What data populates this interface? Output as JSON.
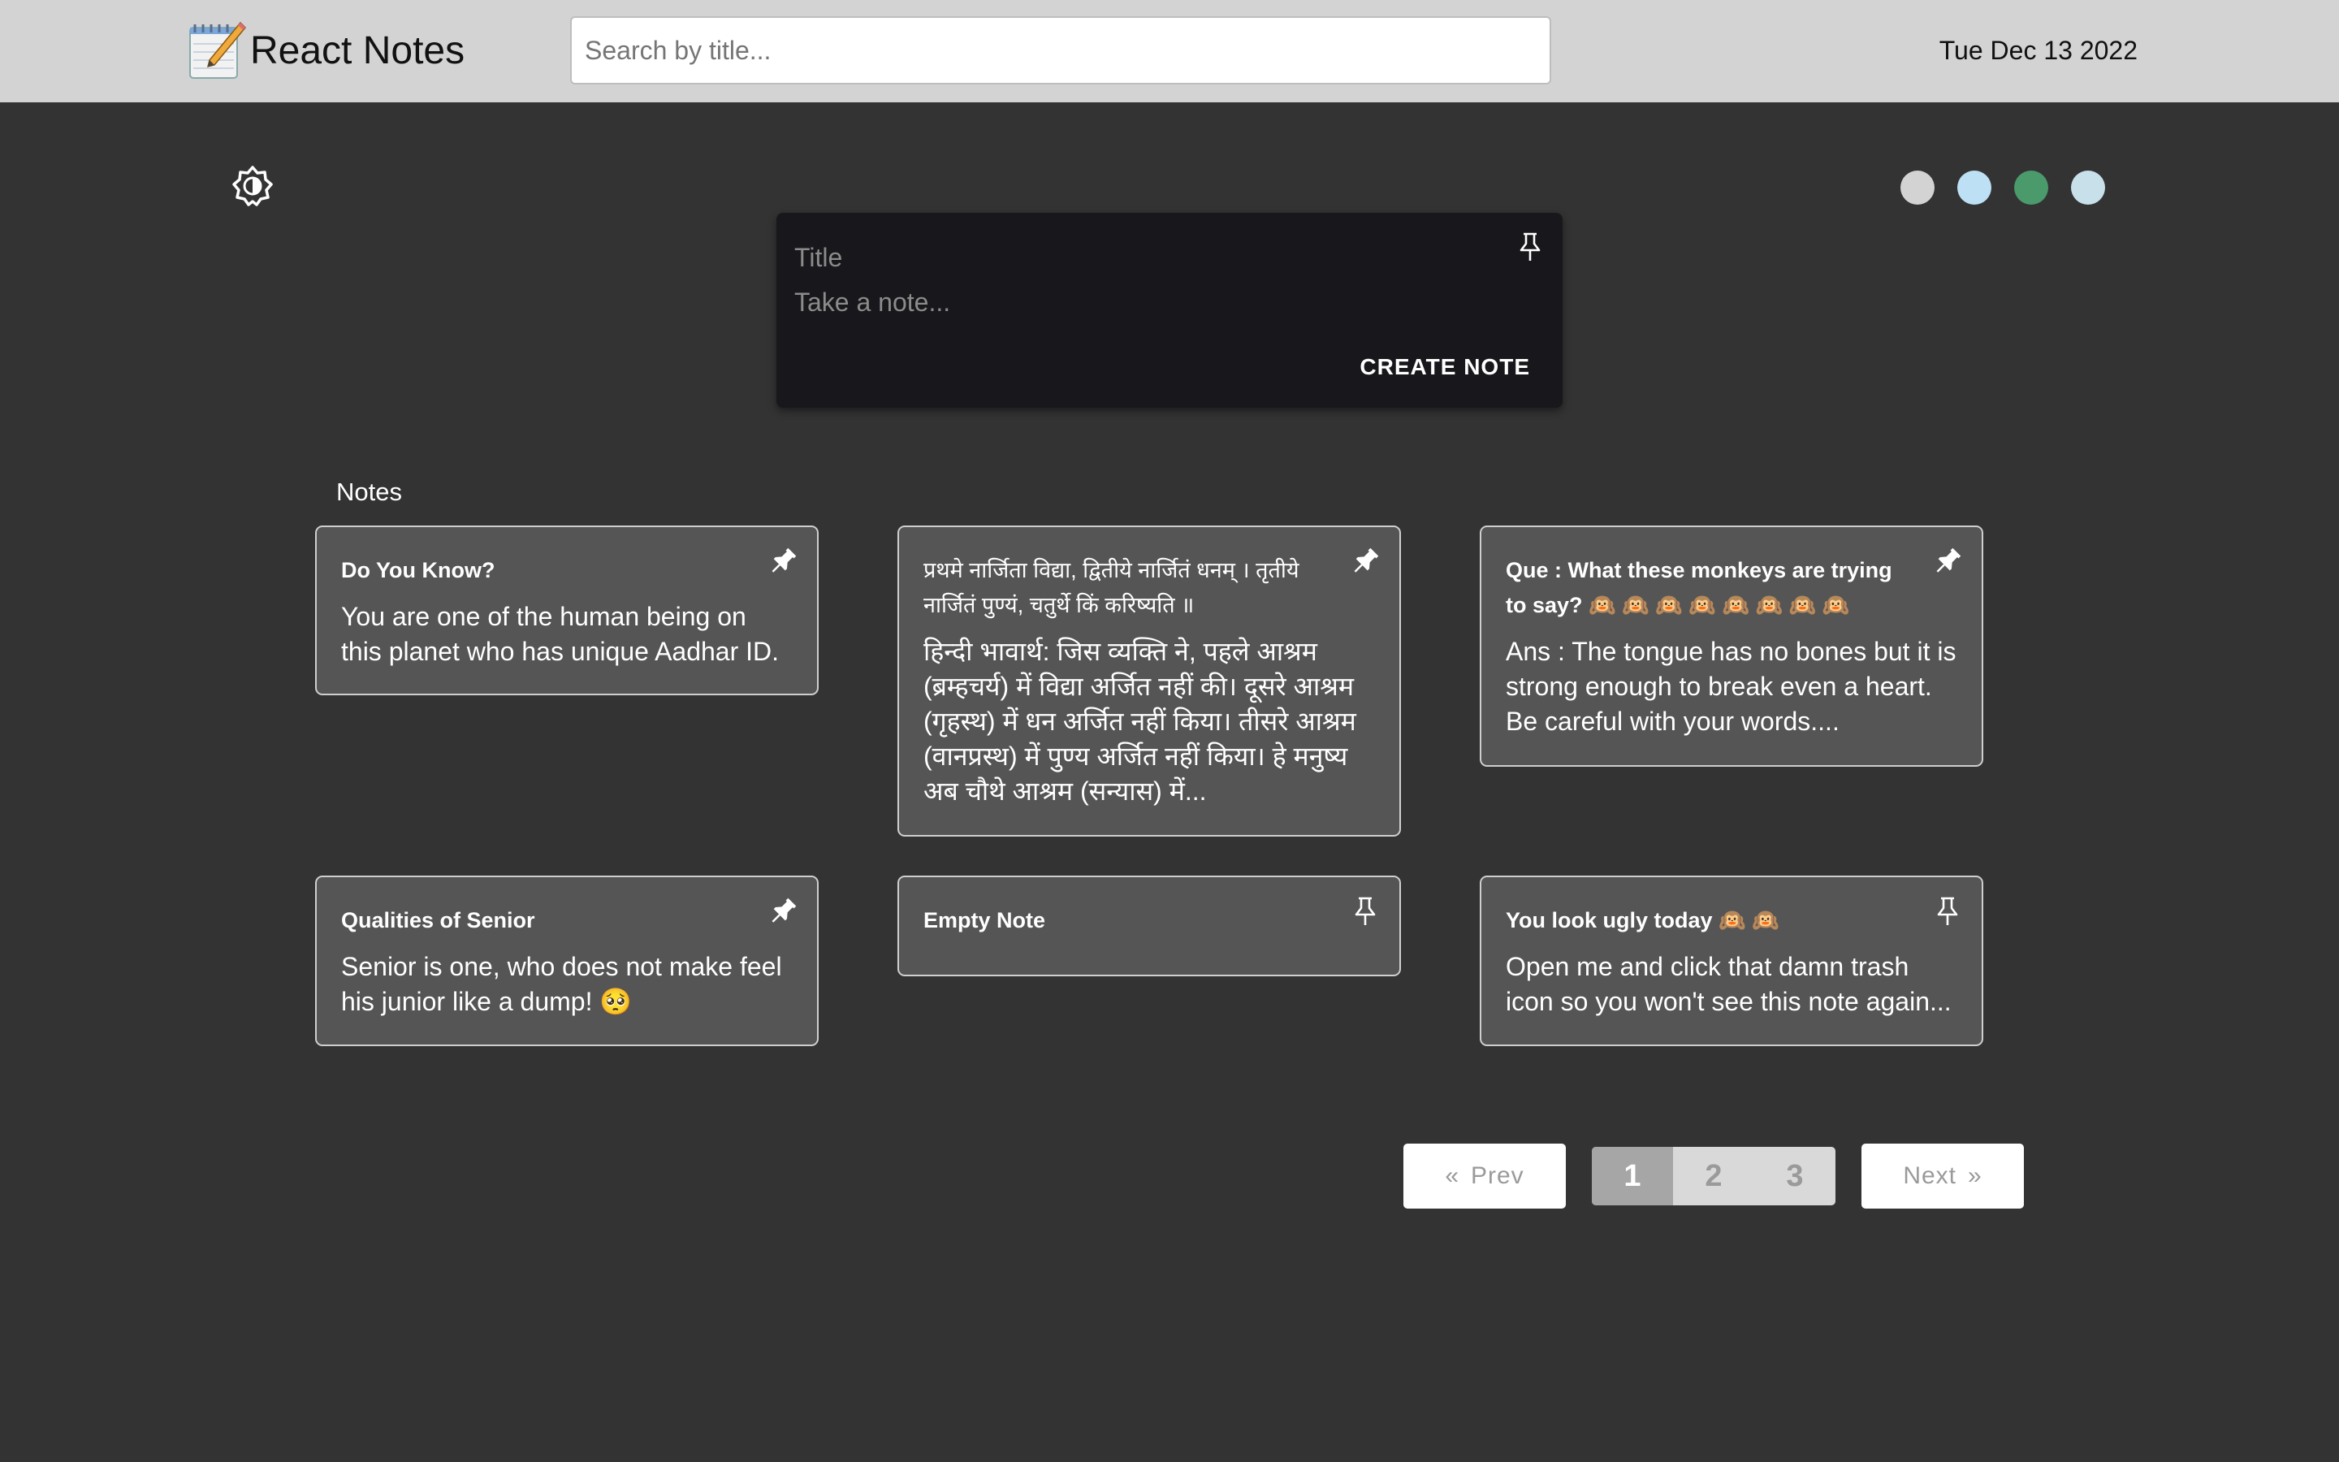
{
  "header": {
    "app_title": "React Notes",
    "search_placeholder": "Search by title...",
    "date": "Tue Dec 13 2022"
  },
  "theme": {
    "toggle_icon": "brightness-icon",
    "colors": [
      "#d3d3d3",
      "#bde0f5",
      "#4a9a6b",
      "#c8e0ea"
    ]
  },
  "create_note": {
    "title_placeholder": "Title",
    "body_placeholder": "Take a note...",
    "button_label": "CREATE NOTE"
  },
  "notes_label": "Notes",
  "notes": [
    {
      "title": "Do You Know?",
      "body": "You are one of the human being on this planet who has unique Aadhar ID.",
      "pinned": true
    },
    {
      "title": "प्रथमे नार्जिता विद्या, द्वितीये नार्जितं धनम् । तृतीये नार्जितं पुण्यं, चतुर्थे किं करिष्यति ॥",
      "body": "हिन्दी भावार्थ: जिस व्यक्ति ने, पहले आश्रम (ब्रम्हचर्य) में विद्या अर्जित नहीं की। दूसरे आश्रम (गृहस्थ) में धन अर्जित नहीं किया। तीसरे आश्रम (वानप्रस्थ) में पुण्य अर्जित नहीं किया। हे मनुष्य अब चौथे आश्रम (सन्यास) में...",
      "pinned": true
    },
    {
      "title": "Que : What these monkeys are trying to say? 🙉 🙉 🙉 🙉 🙉 🙉 🙉 🙉",
      "body": "Ans : The tongue has no bones but it is strong enough to break even a heart. Be careful with your words....",
      "pinned": true
    },
    {
      "title": "Qualities of Senior",
      "body": "Senior is one, who does not make feel his junior like a dump! 🥺",
      "pinned": true
    },
    {
      "title": "Empty Note",
      "body": "",
      "pinned": false
    },
    {
      "title": "You look ugly today 🙉 🙉",
      "body": "Open me and click that damn trash icon so you won't see this note again...",
      "pinned": false
    }
  ],
  "pagination": {
    "prev_label": "Prev",
    "next_label": "Next",
    "pages": [
      "1",
      "2",
      "3"
    ],
    "current_page": "1"
  }
}
